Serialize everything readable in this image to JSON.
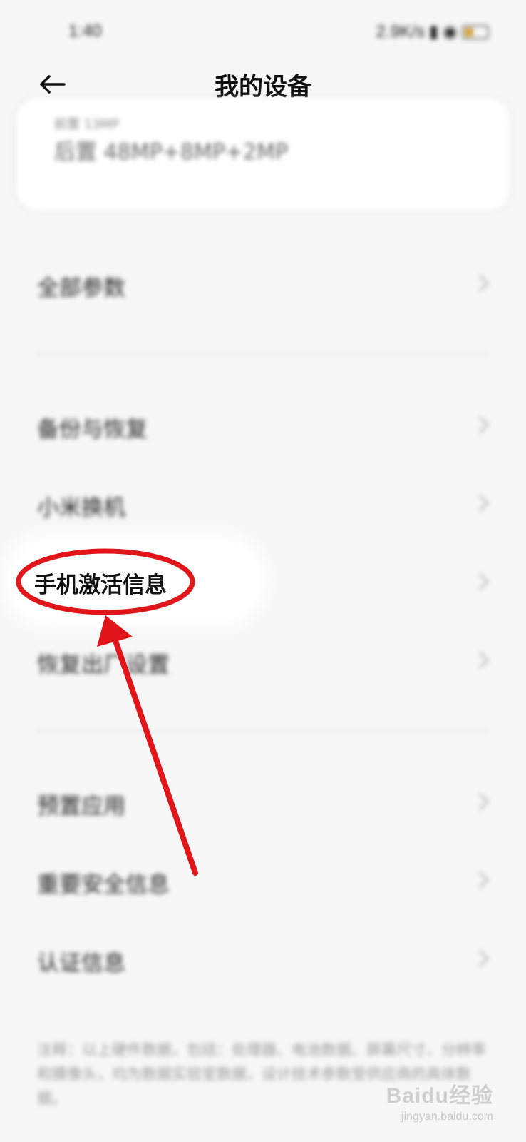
{
  "status_bar": {
    "time": "1:40",
    "network_speed": "2.9K/s",
    "signal_icon": "signal-icon",
    "wifi_icon": "wifi-icon",
    "battery_icon": "battery-icon"
  },
  "header": {
    "title": "我的设备",
    "back_icon": "back-arrow-icon"
  },
  "camera_card": {
    "front_line": "前置 13MP",
    "rear_line": "后置 48MP+8MP+2MP"
  },
  "menu": {
    "all_params": "全部参数",
    "backup_restore": "备份与恢复",
    "mi_mover": "小米换机",
    "activation_info": "手机激活信息",
    "factory_reset": "恢复出厂设置",
    "preinstalled_apps": "预置应用",
    "safety_info": "重要安全信息",
    "certification": "认证信息",
    "chevron_icon": "chevron-right-icon"
  },
  "footer": {
    "note": "注释：以上硬件数据，包括：处理器、电池数据、屏幕尺寸、分辨率和摄像头，均为数据实验室数据，设计技术参数受供应商的具体数据。"
  },
  "annotation": {
    "circle_color": "#e0161b",
    "arrow_color": "#e0161b"
  },
  "watermark": {
    "brand": "Baidu经验",
    "url": "jingyan.baidu.com"
  }
}
